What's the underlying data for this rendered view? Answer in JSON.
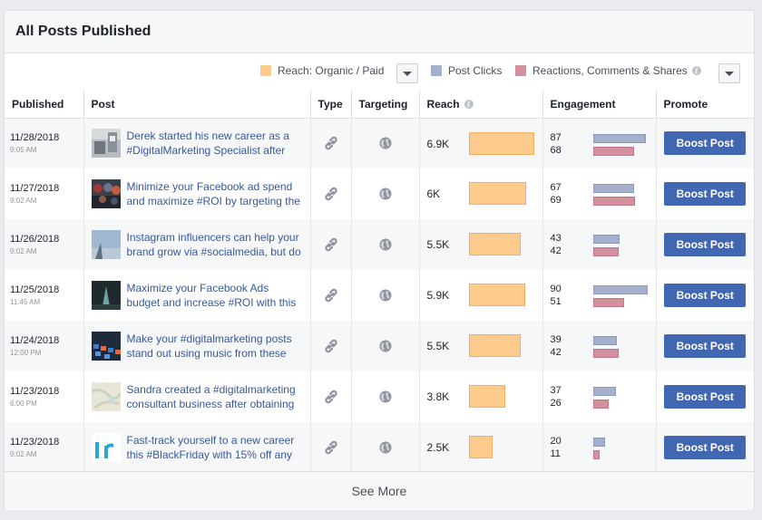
{
  "panel": {
    "title": "All Posts Published"
  },
  "legend": {
    "reach_label": "Reach: Organic / Paid",
    "clicks_label": "Post Clicks",
    "reactions_label": "Reactions, Comments & Shares",
    "colors": {
      "reach": "#ffcb8c",
      "clicks": "#a4b0cc",
      "reactions": "#d4909f"
    }
  },
  "columns": {
    "published": "Published",
    "post": "Post",
    "type": "Type",
    "targeting": "Targeting",
    "reach": "Reach",
    "engagement": "Engagement",
    "promote": "Promote"
  },
  "rows": [
    {
      "date": "11/28/2018",
      "time": "9:05 AM",
      "text": "Derek started his new career as a #DigitalMarketing Specialist after",
      "reach": "6.9K",
      "reach_value": 6900,
      "clicks": "87",
      "reactions": "68",
      "clicks_value": 87,
      "reactions_value": 68,
      "boost": "Boost Post",
      "thumb": "office-photo"
    },
    {
      "date": "11/27/2018",
      "time": "9:02 AM",
      "text": "Minimize your Facebook ad spend and maximize #ROI by targeting the",
      "reach": "6K",
      "reach_value": 6000,
      "clicks": "67",
      "reactions": "69",
      "clicks_value": 67,
      "reactions_value": 69,
      "boost": "Boost Post",
      "thumb": "crowd-photo"
    },
    {
      "date": "11/26/2018",
      "time": "9:02 AM",
      "text": "Instagram influencers can help your brand grow via #socialmedia, but do",
      "reach": "5.5K",
      "reach_value": 5500,
      "clicks": "43",
      "reactions": "42",
      "clicks_value": 43,
      "reactions_value": 42,
      "boost": "Boost Post",
      "thumb": "sky-photo"
    },
    {
      "date": "11/25/2018",
      "time": "11:45 AM",
      "text": "Maximize your Facebook Ads budget and increase #ROI with this",
      "reach": "5.9K",
      "reach_value": 5900,
      "clicks": "90",
      "reactions": "51",
      "clicks_value": 90,
      "reactions_value": 51,
      "boost": "Boost Post",
      "thumb": "dark-photo"
    },
    {
      "date": "11/24/2018",
      "time": "12:00 PM",
      "text": "Make your #digitalmarketing posts stand out using music from these",
      "reach": "5.5K",
      "reach_value": 5500,
      "clicks": "39",
      "reactions": "42",
      "clicks_value": 39,
      "reactions_value": 42,
      "boost": "Boost Post",
      "thumb": "keyboard-photo"
    },
    {
      "date": "11/23/2018",
      "time": "6:00 PM",
      "text": "Sandra created a #digitalmarketing consultant business after obtaining",
      "reach": "3.8K",
      "reach_value": 3800,
      "clicks": "37",
      "reactions": "26",
      "clicks_value": 37,
      "reactions_value": 26,
      "boost": "Boost Post",
      "thumb": "map-photo"
    },
    {
      "date": "11/23/2018",
      "time": "9:02 AM",
      "text": "Fast-track yourself to a new career this #BlackFriday with 15% off any",
      "reach": "2.5K",
      "reach_value": 2500,
      "clicks": "20",
      "reactions": "11",
      "clicks_value": 20,
      "reactions_value": 11,
      "boost": "Boost Post",
      "thumb": "number-graphic"
    }
  ],
  "footer": {
    "see_more": "See More"
  }
}
